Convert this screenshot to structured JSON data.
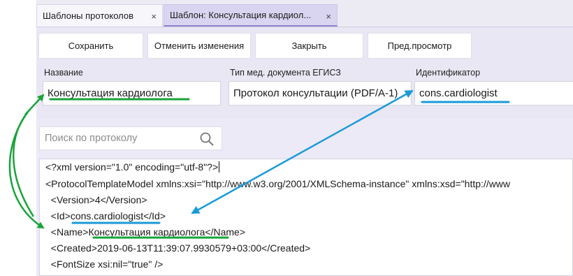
{
  "tabs": [
    {
      "label": "Шаблоны протоколов",
      "close": "×"
    },
    {
      "label": "Шаблон: Консультация кардиол...",
      "close": "×"
    }
  ],
  "toolbar": {
    "save": "Сохранить",
    "revert": "Отменить изменения",
    "close": "Закрыть",
    "preview": "Пред.просмотр"
  },
  "fields": {
    "name_label": "Название",
    "name_value": "Консультация кардиолога",
    "doctype_label": "Тип мед. документа ЕГИСЗ",
    "doctype_value": "Протокол консультации (PDF/A-1)",
    "id_label": "Идентификатор",
    "id_value": "cons.cardiologist"
  },
  "search": {
    "placeholder": "Поиск по протоколу"
  },
  "xml": {
    "line1": "<?xml version=\"1.0\" encoding=\"utf-8\"?>",
    "line2": "<ProtocolTemplateModel xmlns:xsi=\"http://www.w3.org/2001/XMLSchema-instance\" xmlns:xsd=\"http://www",
    "line3": "  <Version>4</Version>",
    "line4_open": "  <Id>",
    "line4_value": "cons.cardiologist",
    "line4_close": "</Id>",
    "line5_open": "  <Name>",
    "line5_value": "Консультация кардиолога",
    "line5_close": "</Name>",
    "line6": "  <Created>2019-06-13T11:39:07.9930579+03:00</Created>",
    "line7": "  <FontSize xsi:nil=\"true\" />"
  },
  "annotation_colors": {
    "green": "#1aa33a",
    "blue": "#1a9ad8"
  }
}
